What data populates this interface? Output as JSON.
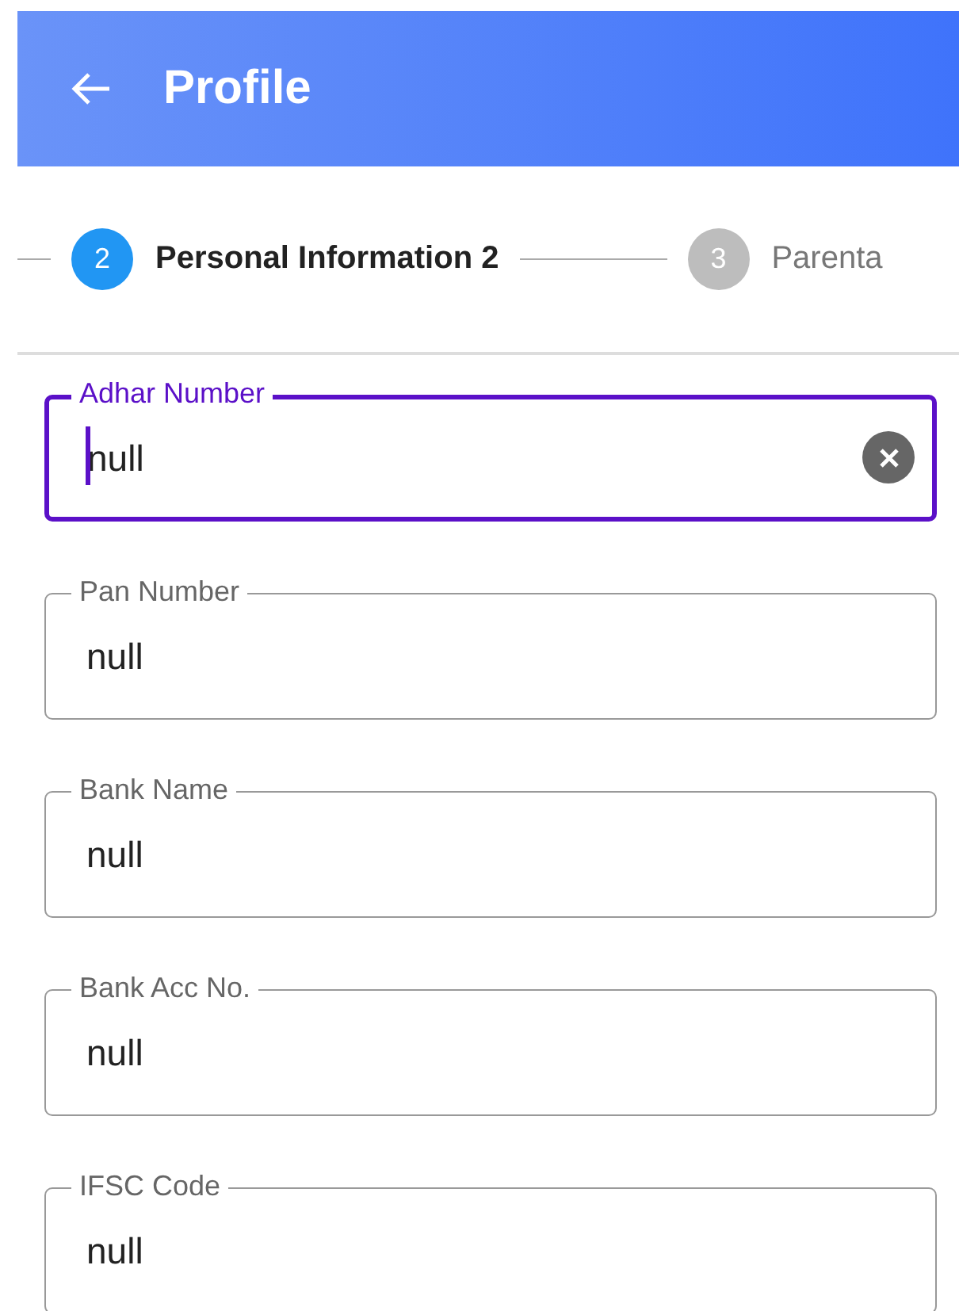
{
  "header": {
    "title": "Profile"
  },
  "stepper": [
    {
      "number": "2",
      "label": "Personal Information 2",
      "active": true
    },
    {
      "number": "3",
      "label": "Parenta",
      "active": false
    }
  ],
  "fields": [
    {
      "label": "Adhar Number",
      "value": "null",
      "focused": true
    },
    {
      "label": "Pan Number",
      "value": "null",
      "focused": false
    },
    {
      "label": "Bank Name",
      "value": "null",
      "focused": false
    },
    {
      "label": "Bank Acc No.",
      "value": "null",
      "focused": false
    },
    {
      "label": "IFSC Code",
      "value": "null",
      "focused": false
    }
  ]
}
